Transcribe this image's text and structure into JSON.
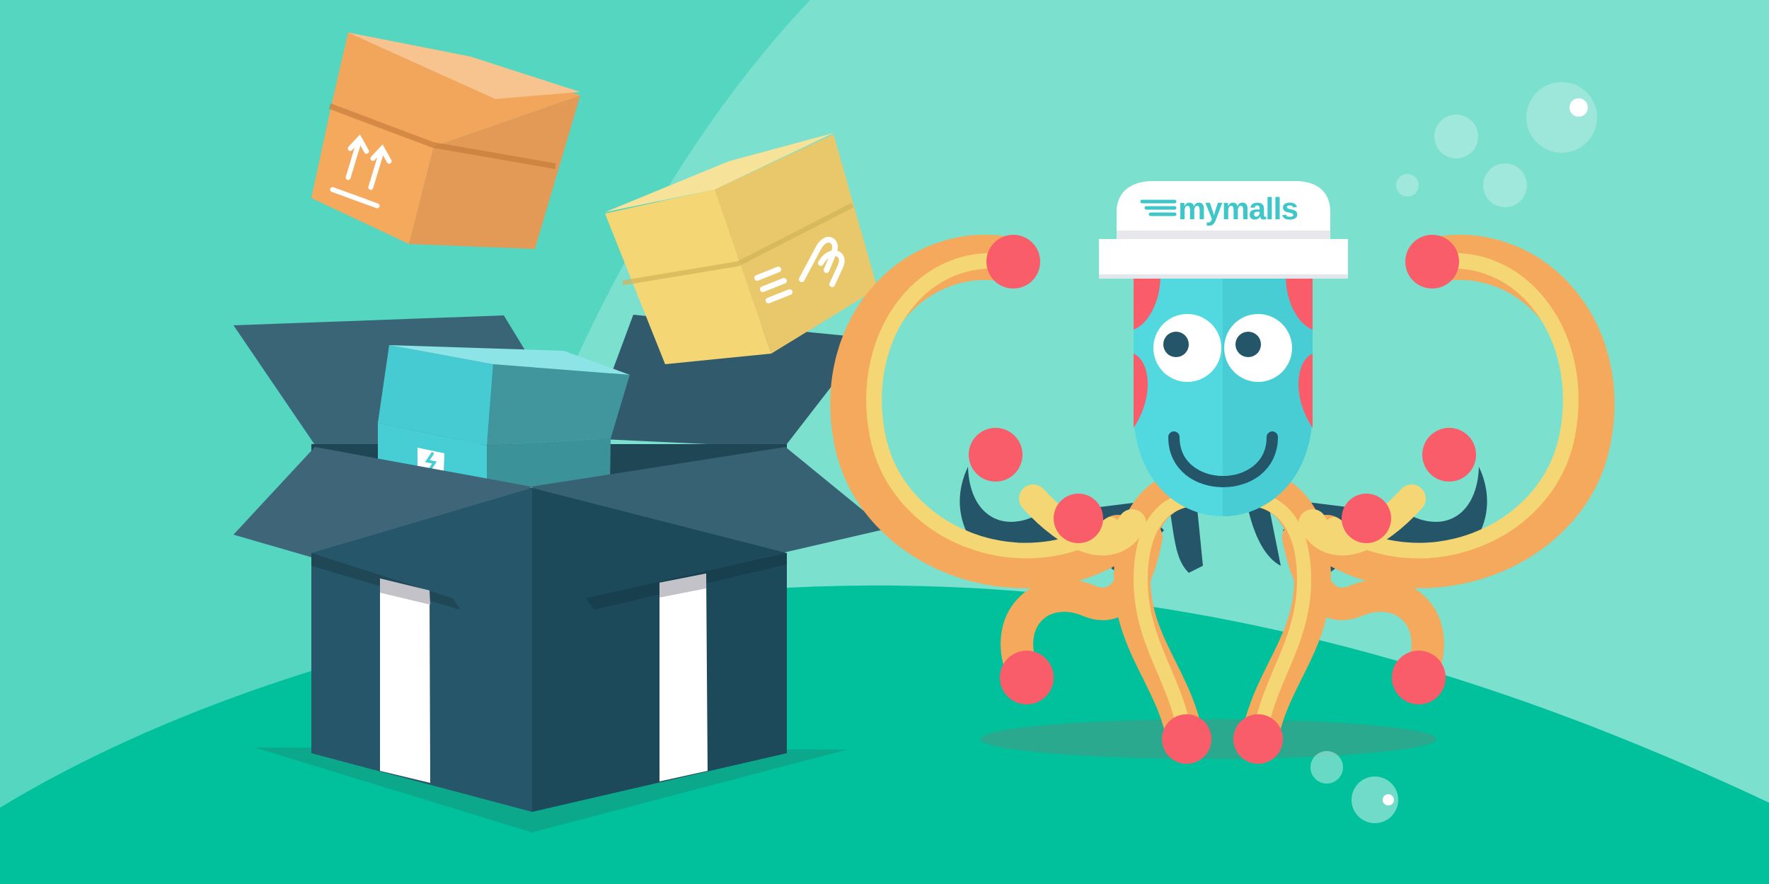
{
  "hat": {
    "brand_text": "mymalls"
  },
  "colors": {
    "background": "#54d6c1",
    "background_light": "#7be0cd",
    "ground": "#00c19b",
    "box_dark": "#245568",
    "box_orange": "#e39a56",
    "box_yellow": "#f4d774",
    "box_teal": "#47ced5",
    "octopus_head": "#52d9df",
    "tentacle_orange": "#f4a95c",
    "tentacle_yellow": "#f4d774",
    "suction_cup": "#f95d6a",
    "hat_white": "#ffffff",
    "brand_teal": "#3ec6c8"
  },
  "icons": {
    "orange_box": "this-side-up-arrows-icon",
    "yellow_box": "mymalls-m-logo-icon",
    "teal_box": "fragile-glass-icon"
  }
}
